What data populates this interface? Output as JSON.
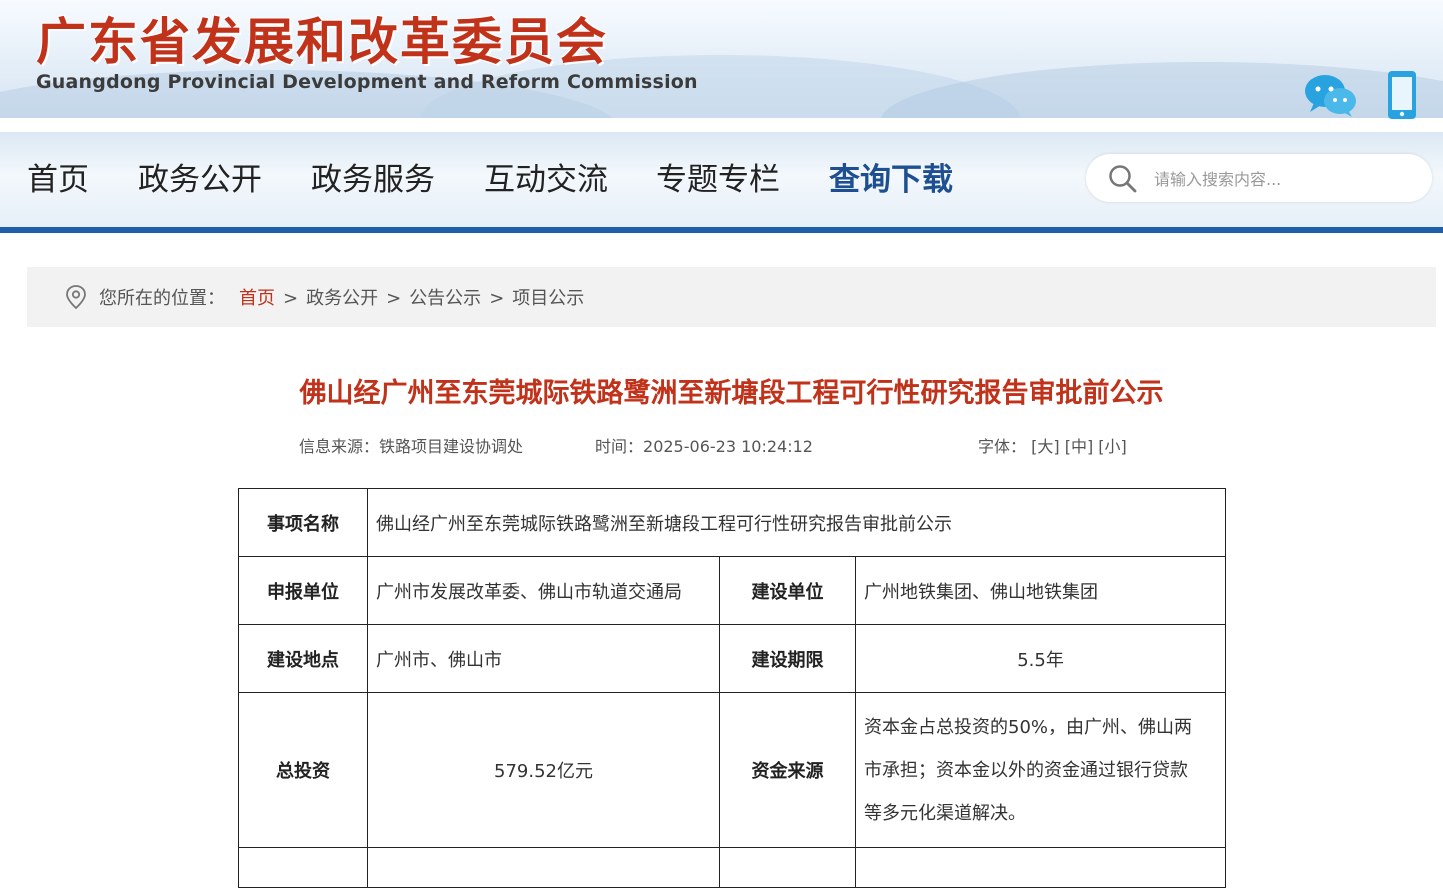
{
  "header": {
    "title": "广东省发展和改革委员会",
    "subtitle": "Guangdong Provincial Development and Reform Commission"
  },
  "nav": {
    "items": [
      "首页",
      "政务公开",
      "政务服务",
      "互动交流",
      "专题专栏",
      "查询下载"
    ],
    "active_index": 5
  },
  "search": {
    "placeholder": "请输入搜索内容..."
  },
  "breadcrumb": {
    "label": "您所在的位置：",
    "items": [
      "首页",
      "政务公开",
      "公告公示",
      "项目公示"
    ],
    "separator": ">"
  },
  "article": {
    "title": "佛山经广州至东莞城际铁路鹭洲至新塘段工程可行性研究报告审批前公示",
    "source_label": "信息来源：",
    "source": "铁路项目建设协调处",
    "time_label": "时间：",
    "time": "2025-06-23 10:24:12",
    "font_label": "字体：",
    "font_options": [
      "[大]",
      "[中]",
      "[小]"
    ]
  },
  "table": {
    "item_name_label": "事项名称",
    "item_name": "佛山经广州至东莞城际铁路鹭洲至新塘段工程可行性研究报告审批前公示",
    "applicant_label": "申报单位",
    "applicant": "广州市发展改革委、佛山市轨道交通局",
    "builder_label": "建设单位",
    "builder": "广州地铁集团、佛山地铁集团",
    "location_label": "建设地点",
    "location": "广州市、佛山市",
    "period_label": "建设期限",
    "period": "5.5年",
    "investment_label": "总投资",
    "investment": "579.52亿元",
    "funding_label": "资金来源",
    "funding_lines": [
      "资本金占总投资的50%，由广州、佛山两",
      "市承担；资本金以外的资金通过银行贷款",
      "等多元化渠道解决。"
    ]
  },
  "colors": {
    "brand_red": "#c0321a",
    "nav_blue": "#1f5ea8",
    "active_nav": "#1d4f91"
  }
}
